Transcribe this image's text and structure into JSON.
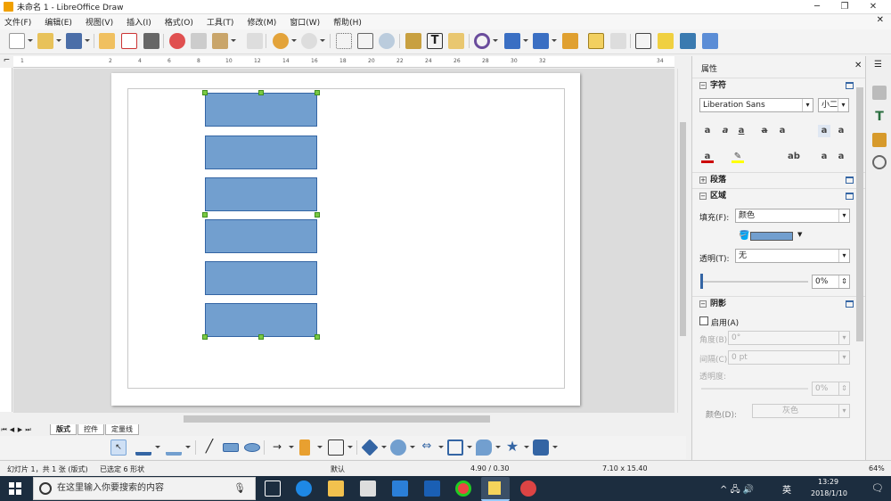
{
  "window": {
    "title": "未命名 1 - LibreOffice Draw"
  },
  "menu": [
    "文件(F)",
    "编辑(E)",
    "视图(V)",
    "插入(I)",
    "格式(O)",
    "工具(T)",
    "修改(M)",
    "窗口(W)",
    "帮助(H)"
  ],
  "ruler": {
    "h_ticks": [
      "1",
      "2",
      "4",
      "6",
      "8",
      "10",
      "12",
      "14",
      "16",
      "18",
      "20",
      "22",
      "24",
      "26",
      "28",
      "30",
      "32",
      "34"
    ]
  },
  "tabs": [
    "版式",
    "控件",
    "定量线"
  ],
  "status": {
    "slide": "幻灯片 1，共 1 张 (版式)",
    "selection": "已选定 6 形状",
    "layer": "默认",
    "position": "4.90 / 0.30",
    "size": "7.10 x 15.40",
    "zoom": "64%"
  },
  "sidebar": {
    "title": "属性",
    "char": {
      "header": "字符",
      "font": "Liberation Sans",
      "size": "小二"
    },
    "paragraph": {
      "header": "段落"
    },
    "area": {
      "header": "区域",
      "fill_label": "填充(F):",
      "fill_value": "颜色",
      "fill_color": "#729fcf",
      "transparency_label": "透明(T):",
      "transparency_value": "无",
      "transparency_pct": "0%"
    },
    "shadow": {
      "header": "阴影",
      "enable_label": "启用(A)",
      "angle_label": "角度(B)",
      "angle_value": "0°",
      "distance_label": "间隔(C)",
      "distance_value": "0 pt",
      "transparency_label": "透明度:",
      "transparency_value": "0%",
      "color_label": "颜色(D):",
      "color_value": "灰色"
    }
  },
  "taskbar": {
    "search_placeholder": "在这里输入你要搜索的内容",
    "time": "13:29",
    "date": "2018/1/10",
    "ime": "英"
  },
  "colors": {
    "shape_fill": "#729fcf",
    "shape_border": "#3465a4",
    "handle": "#7ac943",
    "taskbar": "#1c2d3f"
  }
}
